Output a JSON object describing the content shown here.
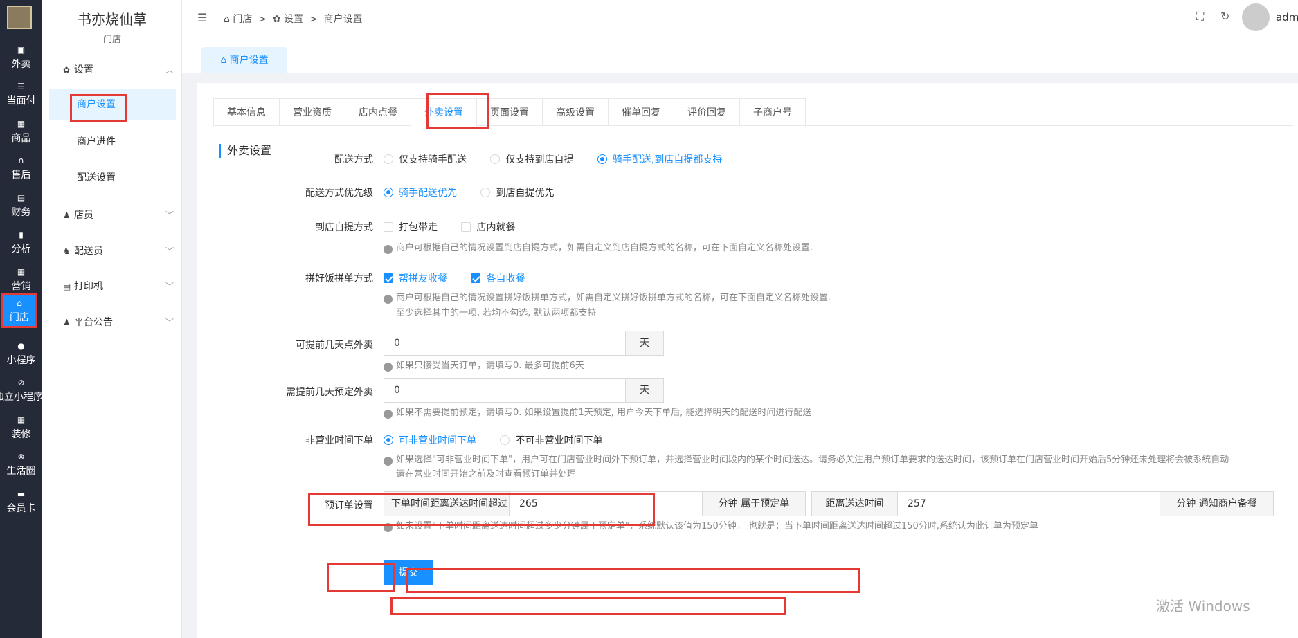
{
  "rail": [
    {
      "label": "外卖",
      "icon": "takeout-icon"
    },
    {
      "label": "当面付",
      "icon": "list-icon"
    },
    {
      "label": "商品",
      "icon": "gift-icon"
    },
    {
      "label": "售后",
      "icon": "headset-icon"
    },
    {
      "label": "财务",
      "icon": "finance-icon"
    },
    {
      "label": "分析",
      "icon": "chart-icon"
    },
    {
      "label": "营销",
      "icon": "gift-icon"
    },
    {
      "label": "门店",
      "icon": "store-icon"
    },
    {
      "label": "小程序",
      "icon": "wechat-icon"
    },
    {
      "label": "独立小程序",
      "icon": "link-icon"
    },
    {
      "label": "装修",
      "icon": "decor-icon"
    },
    {
      "label": "生活圈",
      "icon": "circle-icon"
    },
    {
      "label": "会员卡",
      "icon": "card-icon"
    }
  ],
  "subnav": {
    "shop_name": "书亦烧仙草",
    "shop_sub": "门店",
    "group_settings": "设置",
    "items": [
      "商户设置",
      "商户进件",
      "配送设置"
    ],
    "group_staff": "店员",
    "group_rider": "配送员",
    "group_printer": "打印机",
    "group_notice": "平台公告"
  },
  "breadcrumb": {
    "c1": "门店",
    "c2": "设置",
    "c3": "商户设置",
    "sep": ">"
  },
  "admin": "admin",
  "page_tab": "商户设置",
  "tabs": [
    "基本信息",
    "营业资质",
    "店内点餐",
    "外卖设置",
    "页面设置",
    "高级设置",
    "催单回复",
    "评价回复",
    "子商户号"
  ],
  "section": "外卖设置",
  "form": {
    "delivery": {
      "label": "配送方式",
      "opts": [
        "仅支持骑手配送",
        "仅支持到店自提",
        "骑手配送,到店自提都支持"
      ],
      "selected": 2
    },
    "priority": {
      "label": "配送方式优先级",
      "opts": [
        "骑手配送优先",
        "到店自提优先"
      ],
      "selected": 0
    },
    "pickup": {
      "label": "到店自提方式",
      "opts": [
        "打包带走",
        "店内就餐"
      ],
      "hint": "商户可根据自己的情况设置到店自提方式，如需自定义到店自提方式的名称，可在下面自定义名称处设置."
    },
    "group": {
      "label": "拼好饭拼单方式",
      "opts": [
        "帮拼友收餐",
        "各自收餐"
      ],
      "hint": "商户可根据自己的情况设置拼好饭拼单方式，如需自定义拼好饭拼单方式的名称，可在下面自定义名称处设置.",
      "hint2": "至少选择其中的一项, 若均不勾选, 默认两项都支持"
    },
    "advance_days": {
      "label": "可提前几天点外卖",
      "value": "0",
      "unit": "天",
      "hint": "如果只接受当天订单，请填写0. 最多可提前6天"
    },
    "preorder_days": {
      "label": "需提前几天预定外卖",
      "value": "0",
      "unit": "天",
      "hint": "如果不需要提前预定，请填写0. 如果设置提前1天预定, 用户今天下单后, 能选择明天的配送时间进行配送"
    },
    "offhours": {
      "label": "非营业时间下单",
      "opts": [
        "可非营业时间下单",
        "不可非营业时间下单"
      ],
      "selected": 0,
      "hint": "如果选择\"可非营业时间下单\"，用户可在门店营业时间外下预订单，并选择营业时间段内的某个时间送达。请务必关注用户预订单要求的送达时间，该预订单在门店营业时间开始后5分钟还未处理将会被系统自动",
      "hint2": "请在营业时间开始之前及时查看预订单并处理"
    },
    "reservation": {
      "label": "预订单设置",
      "pre1": "下单时间距离送达时间超过",
      "val1": "265",
      "post1": "分钟 属于预定单",
      "pre2": "距离送达时间",
      "val2": "257",
      "post2": "分钟 通知商户备餐",
      "hint": "如未设置\"下单时间距离送达时间超过多少分钟属于预定单\"，系统默认该值为150分钟。",
      "hint_tail": "也就是：当下单时间距离送达时间超过150分时,系统认为此订单为预定单"
    }
  },
  "submit": "提交",
  "watermark": "激活 Windows"
}
